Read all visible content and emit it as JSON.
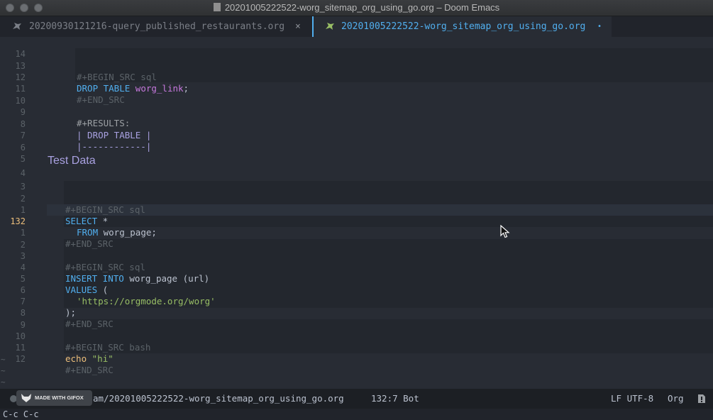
{
  "window": {
    "title": "20201005222522-worg_sitemap_org_using_go.org – Doom Emacs"
  },
  "tabs": [
    {
      "label": "20200930121216-query_published_restaurants.org",
      "close": "×",
      "active": false,
      "icon": "unicorn-icon"
    },
    {
      "label": "20201005222522-worg_sitemap_org_using_go.org",
      "modified": "•",
      "active": true,
      "icon": "unicorn-icon"
    }
  ],
  "lines": {
    "l01": {
      "num": "14"
    },
    "l02": {
      "num": "13",
      "meta": "#+BEGIN_SRC sql"
    },
    "l03": {
      "num": "12",
      "kw": "DROP TABLE",
      "tbl": "worg_link",
      "rest": ";"
    },
    "l04": {
      "num": "11",
      "meta": "#+END_SRC"
    },
    "l05": {
      "num": "10"
    },
    "l06": {
      "num": "9",
      "text": "#+RESULTS:"
    },
    "l07": {
      "num": "8",
      "text": "| DROP TABLE |"
    },
    "l08": {
      "num": "7",
      "text": "|------------|"
    },
    "l09": {
      "num": "6"
    },
    "l10": {
      "num": "5"
    },
    "l11": {
      "num": "4",
      "heading": "Test Data"
    },
    "l12": {
      "num": "3"
    },
    "l13": {
      "num": "2",
      "meta": "#+BEGIN_SRC sql"
    },
    "l14": {
      "num": "1",
      "kw": "SELECT",
      "rest": " *"
    },
    "l15": {
      "num": "132",
      "kw": "FROM",
      "rest": " worg_page;"
    },
    "l16": {
      "num": "1",
      "meta": "#+END_SRC"
    },
    "l17": {
      "num": "2"
    },
    "l18": {
      "num": "3",
      "meta": "#+BEGIN_SRC sql"
    },
    "l19": {
      "num": "4",
      "kw": "INSERT INTO",
      "rest": " worg_page (url)"
    },
    "l20": {
      "num": "5",
      "kw": "VALUES",
      "rest": " ("
    },
    "l21": {
      "num": "6",
      "str": "'https://orgmode.org/worg'"
    },
    "l22": {
      "num": "7",
      "rest": ");"
    },
    "l23": {
      "num": "8",
      "meta": "#+END_SRC"
    },
    "l24": {
      "num": "9"
    },
    "l25": {
      "num": "10",
      "meta": "#+BEGIN_SRC bash"
    },
    "l26": {
      "num": "11",
      "fn": "echo",
      "str": "\"hi\""
    },
    "l27": {
      "num": "12",
      "meta": "#+END_SRC"
    }
  },
  "modeline": {
    "path": "am/20201005222522-worg_sitemap_org_using_go.org",
    "position": "132:7 Bot",
    "encoding": "LF UTF-8",
    "mode": "Org"
  },
  "minibuffer": {
    "text": "C-c C-c"
  },
  "watermark": {
    "text": "MADE WITH GIFOX"
  },
  "colors": {
    "background": "#282c34",
    "accent": "#51afef",
    "keyword": "#51afef",
    "table": "#c678dd",
    "string": "#98be65",
    "function": "#ecbe7b",
    "heading": "#a9a1e1",
    "comment": "#5b6268"
  }
}
